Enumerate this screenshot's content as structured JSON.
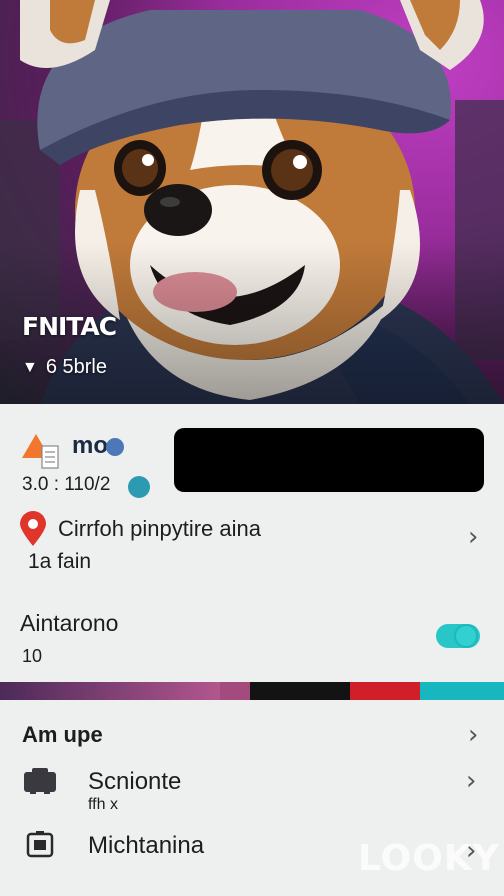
{
  "hero": {
    "title": "FNITAC",
    "meta_icon": "play-triangle-icon",
    "meta_text": "6 5brle"
  },
  "profile": {
    "name": "mo",
    "stat": "3.0 : 110/2",
    "status_color": "#2c9bb2"
  },
  "location": {
    "title": "Cirrfoh pinpytire aina",
    "subtitle": "1a fain"
  },
  "animation": {
    "title": "Aintarono",
    "value": "10",
    "toggle_on": true
  },
  "section": {
    "title": "Am upe",
    "items": [
      {
        "label": "Scnionte",
        "sub": "ffh x",
        "icon": "bag-icon"
      },
      {
        "label": "Michtanina",
        "sub": "",
        "icon": "camera-icon"
      }
    ]
  },
  "watermark": "LOOKY",
  "colors": {
    "accent": "#29c6c8",
    "pin": "#e0352b",
    "warning": "#f0772d"
  }
}
